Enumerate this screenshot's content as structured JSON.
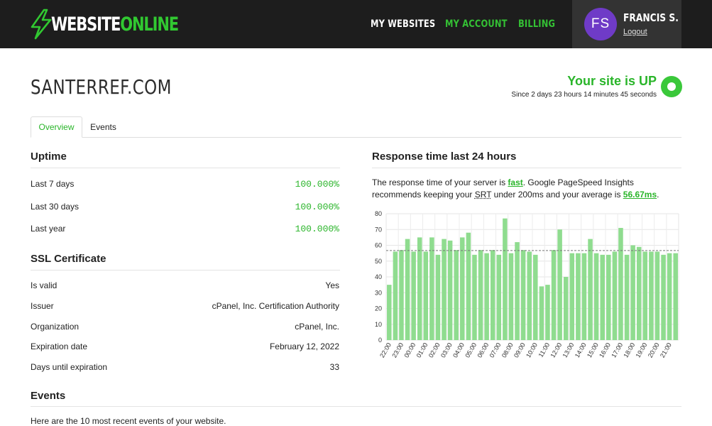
{
  "header": {
    "logo": {
      "part1": "WEBSITE",
      "part2": "ONLINE",
      "icon": "lightning-bolt-icon"
    },
    "nav": [
      {
        "label": "MY WEBSITES"
      },
      {
        "label": "MY ACCOUNT"
      },
      {
        "label": "BILLING"
      }
    ],
    "user": {
      "initials": "FS",
      "name": "FRANCIS S.",
      "logout": "Logout"
    }
  },
  "site": {
    "title": "SANTERREF.COM",
    "status": "Your site is UP",
    "since": "Since 2 days 23 hours 14 minutes 45 seconds"
  },
  "tabs": [
    {
      "label": "Overview",
      "active": true
    },
    {
      "label": "Events",
      "active": false
    }
  ],
  "uptime": {
    "heading": "Uptime",
    "rows": [
      {
        "label": "Last 7 days",
        "value": "100.000%"
      },
      {
        "label": "Last 30 days",
        "value": "100.000%"
      },
      {
        "label": "Last year",
        "value": "100.000%"
      }
    ]
  },
  "ssl": {
    "heading": "SSL Certificate",
    "rows": [
      {
        "label": "Is valid",
        "value": "Yes"
      },
      {
        "label": "Issuer",
        "value": "cPanel, Inc. Certification Authority"
      },
      {
        "label": "Organization",
        "value": "cPanel, Inc."
      },
      {
        "label": "Expiration date",
        "value": "February 12, 2022"
      },
      {
        "label": "Days until expiration",
        "value": "33"
      }
    ]
  },
  "response": {
    "heading": "Response time last 24 hours",
    "text_a": "The response time of your server is ",
    "fast": "fast",
    "text_b": ". Google PageSpeed Insights recommends keeping your ",
    "srt": "SRT",
    "text_c": " under 200ms and your average is ",
    "avg": "56.67ms",
    "text_d": "."
  },
  "events": {
    "heading": "Events",
    "text": "Here are the 10 most recent events of your website."
  },
  "colors": {
    "accent": "#2ab52a",
    "bar": "#8fdc8f",
    "header_bg": "#1d1d1d",
    "avatar": "#6f3bc7"
  },
  "chart_data": {
    "type": "bar",
    "categories": [
      "22:00",
      "23:00",
      "00:00",
      "01:00",
      "02:00",
      "03:00",
      "04:00",
      "05:00",
      "06:00",
      "07:00",
      "08:00",
      "09:00",
      "10:00",
      "11:00",
      "12:00",
      "13:00",
      "14:00",
      "15:00",
      "16:00",
      "17:00",
      "18:00",
      "19:00",
      "20:00",
      "21:00"
    ],
    "values": [
      35,
      56,
      57,
      64,
      56,
      65,
      56,
      65,
      54,
      64,
      63,
      57,
      65,
      68,
      54,
      57,
      55,
      57,
      54,
      77,
      55,
      62,
      57,
      56,
      54,
      34,
      35,
      57,
      70,
      40,
      55,
      55,
      55,
      64,
      55,
      54,
      54,
      56,
      71,
      54,
      60,
      59,
      56,
      56,
      56,
      54,
      55,
      55
    ],
    "average": 56.67,
    "ylim": [
      0,
      80
    ],
    "yticks": [
      0,
      10,
      20,
      30,
      40,
      50,
      60,
      70,
      80
    ],
    "grid": true,
    "average_line": "dashed"
  }
}
